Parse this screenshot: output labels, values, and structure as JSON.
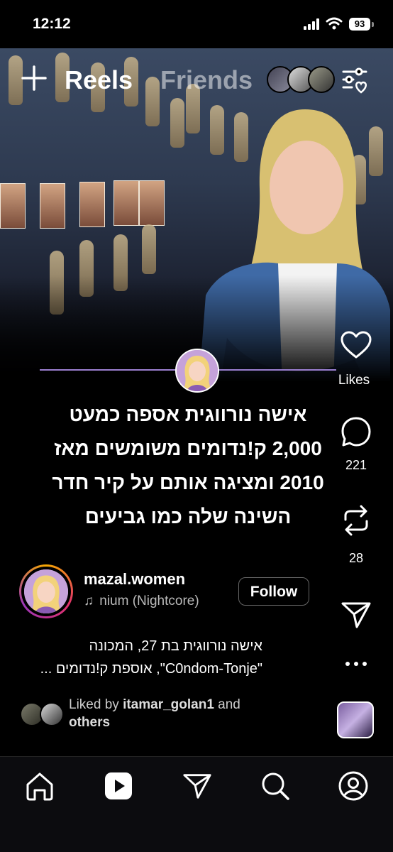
{
  "status_bar": {
    "time": "12:12",
    "battery": "93"
  },
  "header": {
    "tab_reels": "Reels",
    "tab_friends": "Friends"
  },
  "post": {
    "headline": "אישה נורווגית אספה כמעט\n2,000 ק!נדומים משומשים מאז\n2010 ומציגה אותם על קיר חדר\nהשינה שלה כמו גביעים",
    "likes_label": "Likes",
    "comments_count": "221",
    "reposts_count": "28",
    "author": "mazal.women",
    "music": "nium (Nightcore)",
    "follow_label": "Follow",
    "caption_line1": "אישה נורווגית בת 27, המכונה",
    "caption_line2": "\"C0ndom-Tonje\", אוספת ק!נדומים ...",
    "liked_by_prefix": "Liked by",
    "liked_by_user": "itamar_golan1",
    "liked_by_and": "and",
    "liked_by_others": "others"
  },
  "icons": {
    "header": [
      "plus-icon",
      "filter-heart-icon"
    ],
    "actions": [
      "heart-icon",
      "comment-icon",
      "repost-icon",
      "share-icon",
      "more-icon"
    ],
    "music": "music-note-icon",
    "tabs": [
      "home-icon",
      "reels-icon",
      "send-icon",
      "search-icon",
      "profile-icon"
    ]
  },
  "colors": {
    "accent_line": "#9b7fd0",
    "background": "#000000"
  }
}
